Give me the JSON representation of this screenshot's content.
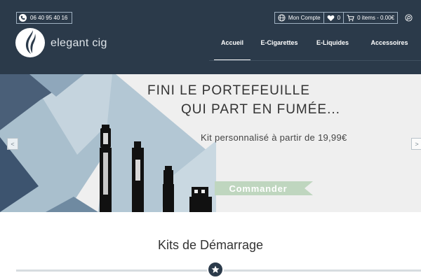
{
  "header": {
    "phone": "06 40 95 40 16",
    "account_label": "Mon Compte",
    "wishlist_count": "0",
    "cart_label": "0 items - 0.00€",
    "logo_text": "elegant cig"
  },
  "nav": {
    "items": [
      {
        "label": "Accueil",
        "active": true
      },
      {
        "label": "E-Cigarettes",
        "active": false
      },
      {
        "label": "E-Liquides",
        "active": false
      },
      {
        "label": "Accessoires",
        "active": false
      }
    ]
  },
  "hero": {
    "line1": "FINI LE PORTEFEUILLE",
    "line2": "QUI PART EN FUMÉE...",
    "subtitle": "Kit personnalisé à partir de 19,99€",
    "cta_label": "Commander",
    "prev_arrow": "<",
    "next_arrow": ">"
  },
  "section": {
    "title": "Kits de Démarrage"
  },
  "icons": {
    "phone": "phone-icon",
    "globe": "globe-icon",
    "heart": "heart-icon",
    "cart": "cart-icon",
    "search": "search-icon",
    "star": "star-icon"
  },
  "colors": {
    "header_bg": "#2b3a4a",
    "cta_green": "#bfd6bf",
    "hero_blue": "#a7bdcc",
    "hero_dark_blue": "#6f8aa1"
  }
}
